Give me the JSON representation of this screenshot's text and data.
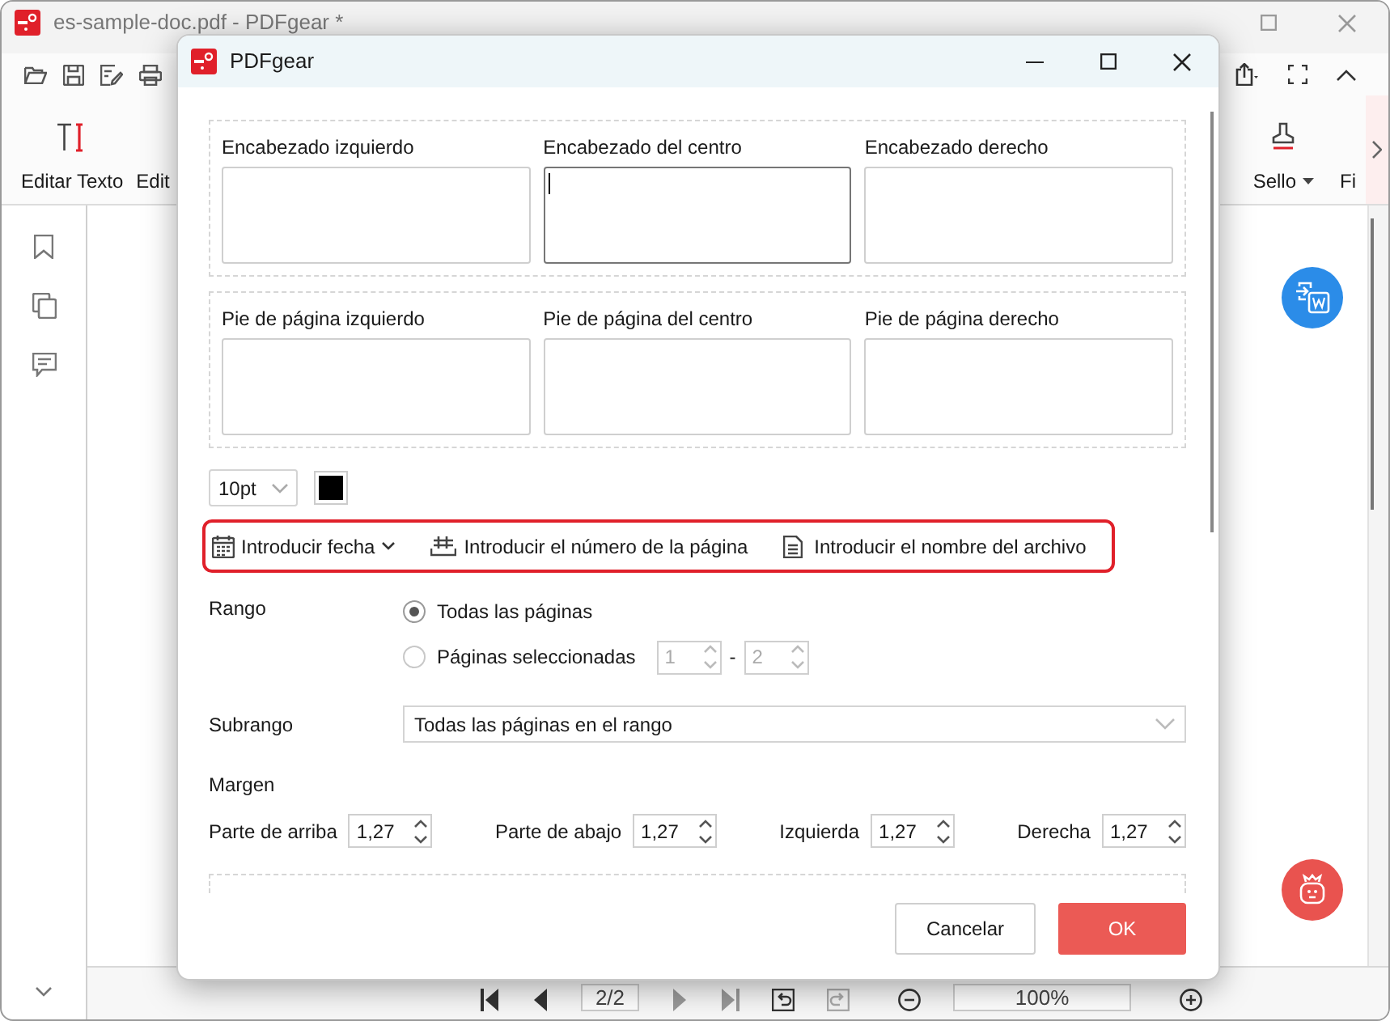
{
  "app": {
    "title": "es-sample-doc.pdf - PDFgear *",
    "ribbon_left": [
      {
        "label": "Editar Texto",
        "kind": "edit-text"
      },
      {
        "label": "Edit",
        "kind": "cut"
      }
    ],
    "ribbon_right": [
      {
        "label": "Sello",
        "kind": "stamp",
        "dropdown": true
      },
      {
        "label": "Fi",
        "kind": "cut",
        "dropdown": false
      }
    ],
    "page_field": "2/2",
    "zoom": "100%"
  },
  "dialog": {
    "title": "PDFgear",
    "header_fields": [
      {
        "label": "Encabezado izquierdo",
        "focused": false
      },
      {
        "label": "Encabezado del centro",
        "focused": true
      },
      {
        "label": "Encabezado derecho",
        "focused": false
      }
    ],
    "footer_fields": [
      {
        "label": "Pie de página izquierdo",
        "focused": false
      },
      {
        "label": "Pie de página del centro",
        "focused": false
      },
      {
        "label": "Pie de página derecho",
        "focused": false
      }
    ],
    "font_size": "10pt",
    "insert_buttons": [
      {
        "label": "Introducir fecha",
        "kind": "date",
        "dropdown": true
      },
      {
        "label": "Introducir el número de la página",
        "kind": "page-number",
        "dropdown": false
      },
      {
        "label": "Introducir el nombre del archivo",
        "kind": "file-name",
        "dropdown": false
      }
    ],
    "range": {
      "label": "Rango",
      "options": [
        {
          "label": "Todas las páginas",
          "selected": true
        },
        {
          "label": "Páginas seleccionadas",
          "selected": false
        }
      ],
      "from": "1",
      "separator": "-",
      "to": "2"
    },
    "subrange": {
      "label": "Subrango",
      "value": "Todas las páginas en el rango"
    },
    "margin": {
      "label": "Margen",
      "fields": [
        {
          "label": "Parte de arriba",
          "value": "1,27"
        },
        {
          "label": "Parte de abajo",
          "value": "1,27"
        },
        {
          "label": "Izquierda",
          "value": "1,27"
        },
        {
          "label": "Derecha",
          "value": "1,27"
        }
      ]
    },
    "buttons": [
      {
        "label": "Cancelar",
        "kind": "secondary"
      },
      {
        "label": "OK",
        "kind": "primary"
      }
    ]
  }
}
